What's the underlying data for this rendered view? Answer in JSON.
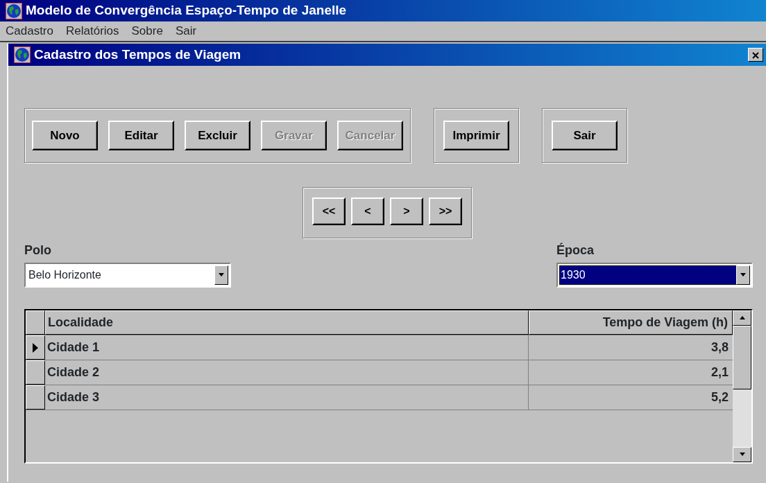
{
  "window": {
    "title": "Modelo de Convergência Espaço-Tempo de Janelle"
  },
  "menu": [
    {
      "label": "Cadastro"
    },
    {
      "label": "Relatórios"
    },
    {
      "label": "Sobre"
    },
    {
      "label": "Sair"
    }
  ],
  "dialog": {
    "title": "Cadastro dos Tempos de Viagem",
    "button_groups": [
      [
        {
          "label": "Novo",
          "disabled": false
        },
        {
          "label": "Editar",
          "disabled": false
        },
        {
          "label": "Excluir",
          "disabled": false
        },
        {
          "label": "Gravar",
          "disabled": true
        },
        {
          "label": "Cancelar",
          "disabled": true
        }
      ],
      [
        {
          "label": "Imprimir",
          "disabled": false
        }
      ],
      [
        {
          "label": "Sair",
          "disabled": false
        }
      ]
    ],
    "navigator": [
      "<<",
      "<",
      ">",
      ">>"
    ],
    "fields": [
      {
        "label": "Polo",
        "value": "Belo Horizonte",
        "focused": false
      },
      {
        "label": "Época",
        "value": "1930",
        "focused": true
      }
    ],
    "table": {
      "columns": [
        "Localidade",
        "Tempo de Viagem (h)"
      ],
      "rows": [
        {
          "cells": [
            "Cidade 1",
            "3,8"
          ],
          "selected": true
        },
        {
          "cells": [
            "Cidade 2",
            "2,1"
          ],
          "selected": false
        },
        {
          "cells": [
            "Cidade 3",
            "5,2"
          ],
          "selected": false
        }
      ]
    }
  }
}
